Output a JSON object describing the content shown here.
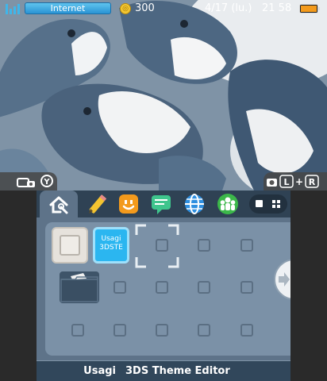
{
  "status_bar": {
    "connection_label": "Internet",
    "play_coins": "300",
    "date": "4/17 (lu.)",
    "time": "21 58",
    "icons": [
      "signal-icon",
      "coin-icon",
      "battery-icon"
    ]
  },
  "top_screen": {
    "wallpaper": "photo of plush shark toys",
    "camera_shortcut_icon": "camera-y-button-icon",
    "screenshot_shortcut_icon": "camera-l-r-button-icon"
  },
  "bottom_screen": {
    "menu_apps": [
      {
        "name": "settings",
        "icon": "home-settings-icon"
      },
      {
        "name": "notes",
        "icon": "pencil-icon"
      },
      {
        "name": "friends",
        "icon": "smiley-icon"
      },
      {
        "name": "notifications",
        "icon": "speech-bubble-icon"
      },
      {
        "name": "browser",
        "icon": "globe-icon"
      },
      {
        "name": "miiverse",
        "icon": "people-icon"
      }
    ],
    "selected_app": {
      "tile_label": "Usagi\n3DSTE",
      "author": "Usagi",
      "title": "3DS Theme Editor"
    },
    "colors": {
      "background": "#5e7389",
      "panel": "#7b91a7",
      "top_bar": "#2f4254",
      "accent_blue": "#3fb6ea"
    }
  }
}
